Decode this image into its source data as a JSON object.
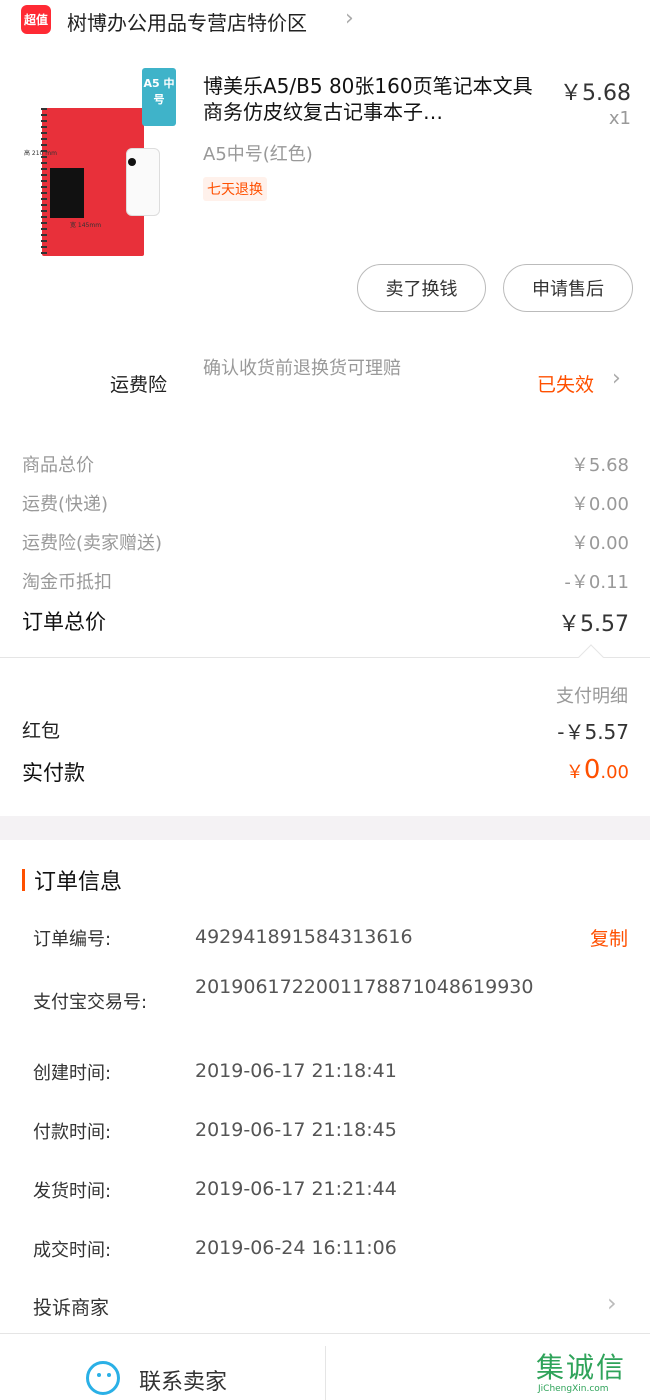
{
  "shop": {
    "badge": "超值",
    "name": "树博办公用品专营店特价区"
  },
  "product": {
    "title": "博美乐A5/B5 80张160页笔记本文具商务仿皮纹复古记事本子…",
    "price": "￥5.68",
    "qty": "x1",
    "spec": "A5中号(红色)",
    "return_tag": "七天退换",
    "image_tag": "A5 中号",
    "image_dim_v": "高 210 mm",
    "image_dim_h": "宽 145mm"
  },
  "actions": {
    "sell_label": "卖了换钱",
    "after_sale_label": "申请售后"
  },
  "insurance": {
    "label": "运费险",
    "desc": "确认收货前退换货可理赔",
    "status": "已失效"
  },
  "fees": [
    {
      "label": "商品总价",
      "value": "￥5.68"
    },
    {
      "label": "运费(快递)",
      "value": "￥0.00"
    },
    {
      "label": "运费险(卖家赠送)",
      "value": "￥0.00"
    },
    {
      "label": "淘金币抵扣",
      "value": "-￥0.11"
    }
  ],
  "total": {
    "label": "订单总价",
    "value": "￥5.57"
  },
  "payment": {
    "detail_link": "支付明细",
    "hongbao_label": "红包",
    "hongbao_value": "-￥5.57",
    "paid_label": "实付款",
    "paid_currency": "￥",
    "paid_int": "0",
    "paid_dec": ".00"
  },
  "order_info": {
    "title": "订单信息",
    "copy_label": "复制",
    "rows": [
      {
        "label": "订单编号:",
        "value": "492941891584313616"
      },
      {
        "label": "支付宝交易号:",
        "value": "2019061722001178871048619930"
      },
      {
        "label": "创建时间:",
        "value": "2019-06-17 21:18:41"
      },
      {
        "label": "付款时间:",
        "value": "2019-06-17 21:18:45"
      },
      {
        "label": "发货时间:",
        "value": "2019-06-17 21:21:44"
      },
      {
        "label": "成交时间:",
        "value": "2019-06-24 16:11:06"
      }
    ],
    "complain_label": "投诉商家"
  },
  "bottom": {
    "contact_label": "联系卖家",
    "watermark_main": "集诚信",
    "watermark_sub": "JiChengXin.com"
  },
  "colors": {
    "accent": "#ff5000",
    "badge_red": "#ff2a34",
    "contact_blue": "#2ab0e6"
  }
}
